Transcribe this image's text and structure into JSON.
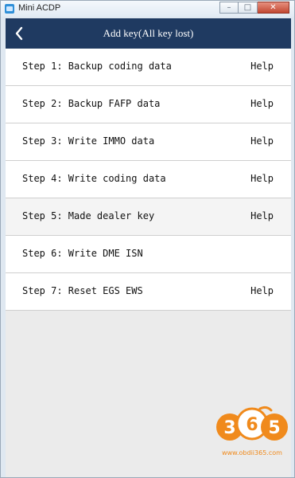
{
  "window": {
    "app_title": "Mini ACDP",
    "controls": {
      "minimize": "–",
      "maximize": "□",
      "close": "✕"
    }
  },
  "header": {
    "title": "Add key(All key lost)",
    "back_icon": "chevron-left-icon"
  },
  "steps": [
    {
      "label": "Step 1: Backup coding data",
      "help": "Help"
    },
    {
      "label": "Step 2: Backup FAFP data",
      "help": "Help"
    },
    {
      "label": "Step 3: Write IMMO data",
      "help": "Help"
    },
    {
      "label": "Step 4: Write coding data",
      "help": "Help"
    },
    {
      "label": "Step 5: Made dealer key",
      "help": "Help"
    },
    {
      "label": "Step 6: Write DME ISN",
      "help": ""
    },
    {
      "label": "Step 7: Reset EGS EWS",
      "help": "Help"
    }
  ],
  "watermark": {
    "logo_text": "365",
    "url": "www.obdii365.com"
  },
  "colors": {
    "header_bg": "#1f3a61",
    "list_bg": "#ffffff",
    "shaded_row_bg": "#f4f4f4",
    "logo_orange": "#f08a1c"
  }
}
